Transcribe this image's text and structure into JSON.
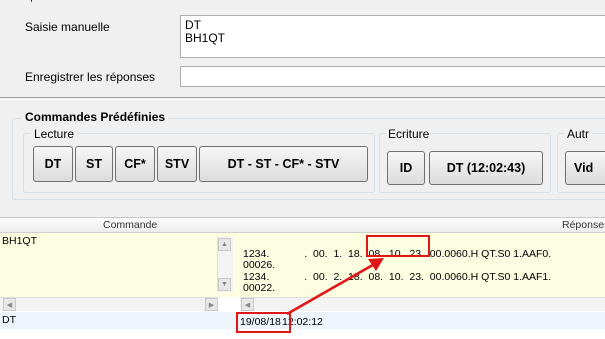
{
  "form": {
    "manual_label": "Saisie manuelle",
    "manual_value_line1": "DT",
    "manual_value_line2": "BH1QT",
    "save_label": "Enregistrer les réponses",
    "save_value": ""
  },
  "predefined": {
    "title": "Commandes Prédéfinies",
    "read_group": "Lecture",
    "write_group": "Ecriture",
    "other_group": "Autr",
    "read_buttons": [
      "DT",
      "ST",
      "CF*",
      "STV",
      "DT - ST - CF* - STV"
    ],
    "write_buttons": [
      "ID",
      "DT (12:02:43)"
    ],
    "other_buttons": [
      "Vid"
    ]
  },
  "table": {
    "col_command": "Commande",
    "col_response": "Réponse",
    "rows": [
      {
        "command": "BH1QT",
        "resp_line1": "1234.            .  00.  1.  18.  08.  10.  23.  00.0060.H QT.S0 1.AAF0.",
        "resp_line2": "00026.",
        "resp_line3": "1234.            .  00.  2.  18.  08.  10.  23.  00.0060.H QT.S0 1.AAF1.",
        "resp_line4": "00022."
      },
      {
        "command": "DT",
        "resp_date": "19/08/18",
        "resp_time": "12:02:12"
      }
    ]
  },
  "colors": {
    "highlight_row": "#fdfde2",
    "selected_row": "#eef4fb",
    "annotation_red": "#e01515"
  }
}
